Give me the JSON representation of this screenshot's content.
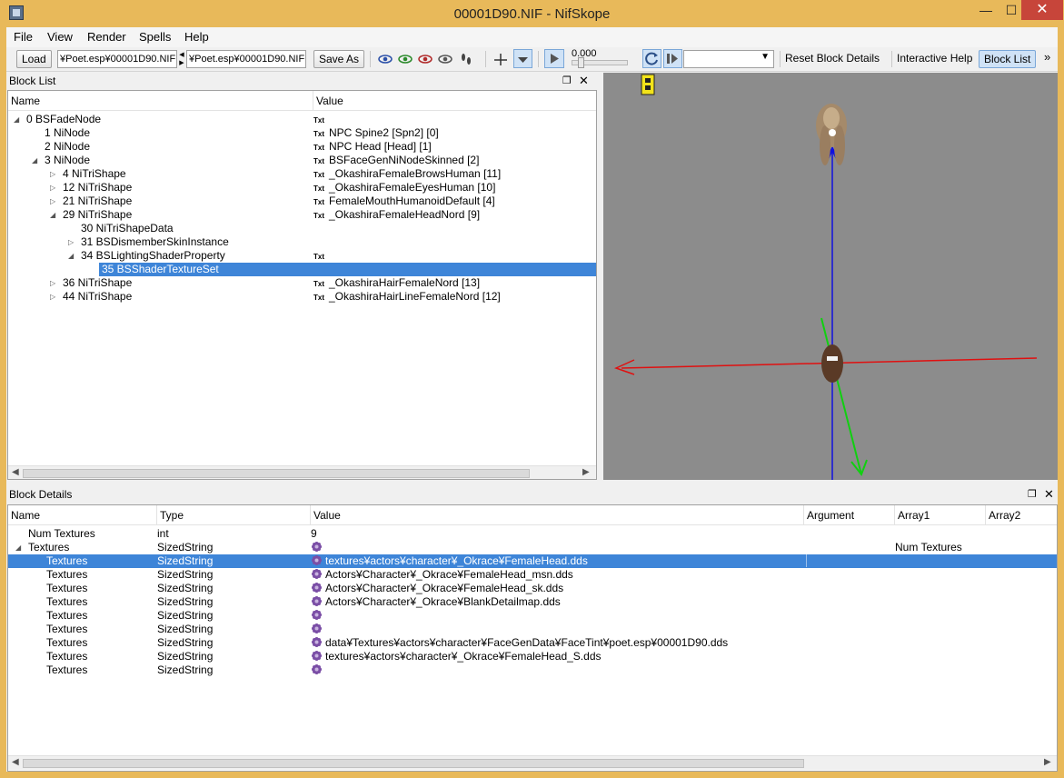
{
  "window": {
    "title": "00001D90.NIF - NifSkope"
  },
  "menu": [
    "File",
    "View",
    "Render",
    "Spells",
    "Help"
  ],
  "toolbar": {
    "load_label": "Load",
    "load_path": "¥Poet.esp¥00001D90.NIF",
    "save_path": "¥Poet.esp¥00001D90.NIF",
    "save_as_label": "Save As",
    "time_value": "0.000",
    "reset_block_details": "Reset Block Details",
    "interactive_help": "Interactive Help",
    "block_list": "Block List",
    "more": "»"
  },
  "block_list": {
    "title": "Block List",
    "columns": [
      "Name",
      "Value"
    ],
    "rows": [
      {
        "name": "0 BSFadeNode",
        "value": "",
        "txt": true,
        "depth": 0,
        "expand": "open"
      },
      {
        "name": "1 NiNode",
        "value": "NPC Spine2 [Spn2] [0]",
        "txt": true,
        "depth": 1,
        "expand": ""
      },
      {
        "name": "2 NiNode",
        "value": "NPC Head [Head] [1]",
        "txt": true,
        "depth": 1,
        "expand": ""
      },
      {
        "name": "3 NiNode",
        "value": "BSFaceGenNiNodeSkinned [2]",
        "txt": true,
        "depth": 1,
        "expand": "open"
      },
      {
        "name": "4 NiTriShape",
        "value": "_OkashiraFemaleBrowsHuman [11]",
        "txt": true,
        "depth": 2,
        "expand": "closed"
      },
      {
        "name": "12 NiTriShape",
        "value": "_OkashiraFemaleEyesHuman [10]",
        "txt": true,
        "depth": 2,
        "expand": "closed"
      },
      {
        "name": "21 NiTriShape",
        "value": "FemaleMouthHumanoidDefault [4]",
        "txt": true,
        "depth": 2,
        "expand": "closed"
      },
      {
        "name": "29 NiTriShape",
        "value": "_OkashiraFemaleHeadNord [9]",
        "txt": true,
        "depth": 2,
        "expand": "open"
      },
      {
        "name": "30 NiTriShapeData",
        "value": "",
        "txt": false,
        "depth": 3,
        "expand": ""
      },
      {
        "name": "31 BSDismemberSkinInstance",
        "value": "",
        "txt": false,
        "depth": 3,
        "expand": "closed"
      },
      {
        "name": "34 BSLightingShaderProperty",
        "value": "",
        "txt": true,
        "depth": 3,
        "expand": "open"
      },
      {
        "name": "35 BSShaderTextureSet",
        "value": "",
        "txt": false,
        "depth": 4,
        "expand": "",
        "selected": true
      },
      {
        "name": "36 NiTriShape",
        "value": "_OkashiraHairFemaleNord [13]",
        "txt": true,
        "depth": 2,
        "expand": "closed"
      },
      {
        "name": "44 NiTriShape",
        "value": "_OkashiraHairLineFemaleNord [12]",
        "txt": true,
        "depth": 2,
        "expand": "closed"
      }
    ]
  },
  "txt_tag": "Txt",
  "block_details": {
    "title": "Block Details",
    "columns": [
      "Name",
      "Type",
      "Value",
      "Argument",
      "Array1",
      "Array2"
    ],
    "rows": [
      {
        "name": "Num Textures",
        "type": "int",
        "value": "9",
        "flower": false,
        "array1": "",
        "depth": 1,
        "expand": ""
      },
      {
        "name": "Textures",
        "type": "SizedString",
        "value": "",
        "flower": true,
        "array1": "Num Textures",
        "depth": 1,
        "expand": "open"
      },
      {
        "name": "Textures",
        "type": "SizedString",
        "value": "textures¥actors¥character¥_Okrace¥FemaleHead.dds",
        "flower": true,
        "array1": "",
        "depth": 2,
        "expand": "",
        "selected": true
      },
      {
        "name": "Textures",
        "type": "SizedString",
        "value": "Actors¥Character¥_Okrace¥FemaleHead_msn.dds",
        "flower": true,
        "array1": "",
        "depth": 2,
        "expand": ""
      },
      {
        "name": "Textures",
        "type": "SizedString",
        "value": "Actors¥Character¥_Okrace¥FemaleHead_sk.dds",
        "flower": true,
        "array1": "",
        "depth": 2,
        "expand": ""
      },
      {
        "name": "Textures",
        "type": "SizedString",
        "value": "Actors¥Character¥_Okrace¥BlankDetailmap.dds",
        "flower": true,
        "array1": "",
        "depth": 2,
        "expand": ""
      },
      {
        "name": "Textures",
        "type": "SizedString",
        "value": "",
        "flower": true,
        "array1": "",
        "depth": 2,
        "expand": ""
      },
      {
        "name": "Textures",
        "type": "SizedString",
        "value": "",
        "flower": true,
        "array1": "",
        "depth": 2,
        "expand": ""
      },
      {
        "name": "Textures",
        "type": "SizedString",
        "value": "data¥Textures¥actors¥character¥FaceGenData¥FaceTint¥poet.esp¥00001D90.dds",
        "flower": true,
        "array1": "",
        "depth": 2,
        "expand": ""
      },
      {
        "name": "Textures",
        "type": "SizedString",
        "value": "textures¥actors¥character¥_Okrace¥FemaleHead_S.dds",
        "flower": true,
        "array1": "",
        "depth": 2,
        "expand": ""
      },
      {
        "name": "Textures",
        "type": "SizedString",
        "value": "",
        "flower": true,
        "array1": "",
        "depth": 2,
        "expand": ""
      }
    ]
  },
  "colors": {
    "selection": "#3e85d8",
    "title_bar": "#e8b95a",
    "close_button": "#c7453a",
    "viewport_bg": "#8c8c8c",
    "axis_x": "#e01010",
    "axis_y": "#10d010",
    "axis_z": "#1010e0"
  }
}
